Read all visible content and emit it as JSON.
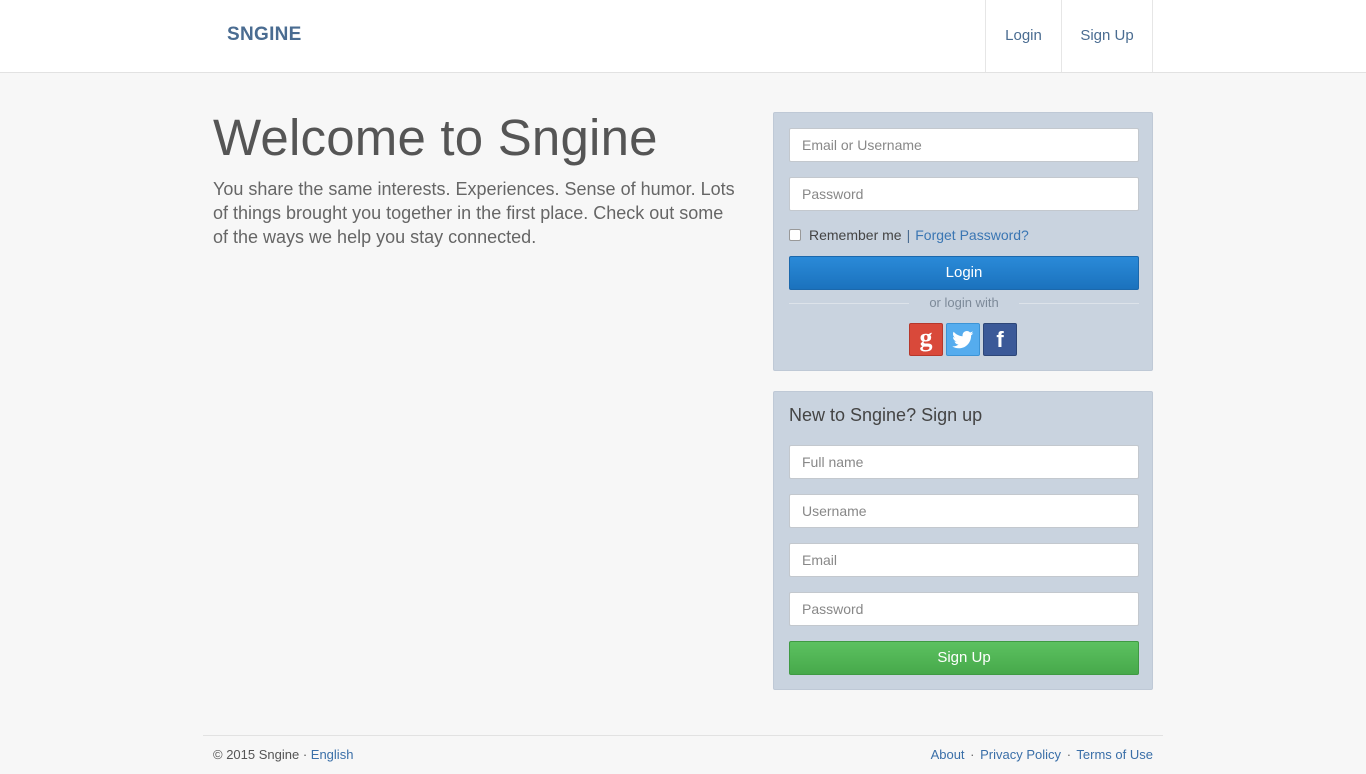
{
  "navbar": {
    "brand": "SNGINE",
    "login": "Login",
    "signup": "Sign Up"
  },
  "hero": {
    "title": "Welcome to Sngine",
    "text": "You share the same interests. Experiences. Sense of humor. Lots of things brought you together in the first place. Check out some of the ways we help you stay connected."
  },
  "login_form": {
    "username_placeholder": "Email or Username",
    "password_placeholder": "Password",
    "remember_label": "Remember me",
    "separator": "|",
    "forget_label": "Forget Password?",
    "submit_label": "Login",
    "social_divider": "or login with",
    "social": [
      {
        "name": "google",
        "glyph": "g",
        "color": "#d9493a"
      },
      {
        "name": "twitter",
        "glyph": "twitter-bird",
        "color": "#55acee"
      },
      {
        "name": "facebook",
        "glyph": "f",
        "color": "#3b5998"
      }
    ]
  },
  "signup_form": {
    "title": "New to Sngine? Sign up",
    "fullname_placeholder": "Full name",
    "username_placeholder": "Username",
    "email_placeholder": "Email",
    "password_placeholder": "Password",
    "submit_label": "Sign Up"
  },
  "footer": {
    "copyright": "© 2015 Sngine ·",
    "language": "English",
    "links": {
      "about": "About",
      "privacy": "Privacy Policy",
      "terms": "Terms of Use"
    },
    "dot": "·"
  },
  "colors": {
    "brand": "#4a6c91",
    "login_button": "#1b72bd",
    "signup_button": "#47a94b",
    "panel": "#c9d3df"
  }
}
